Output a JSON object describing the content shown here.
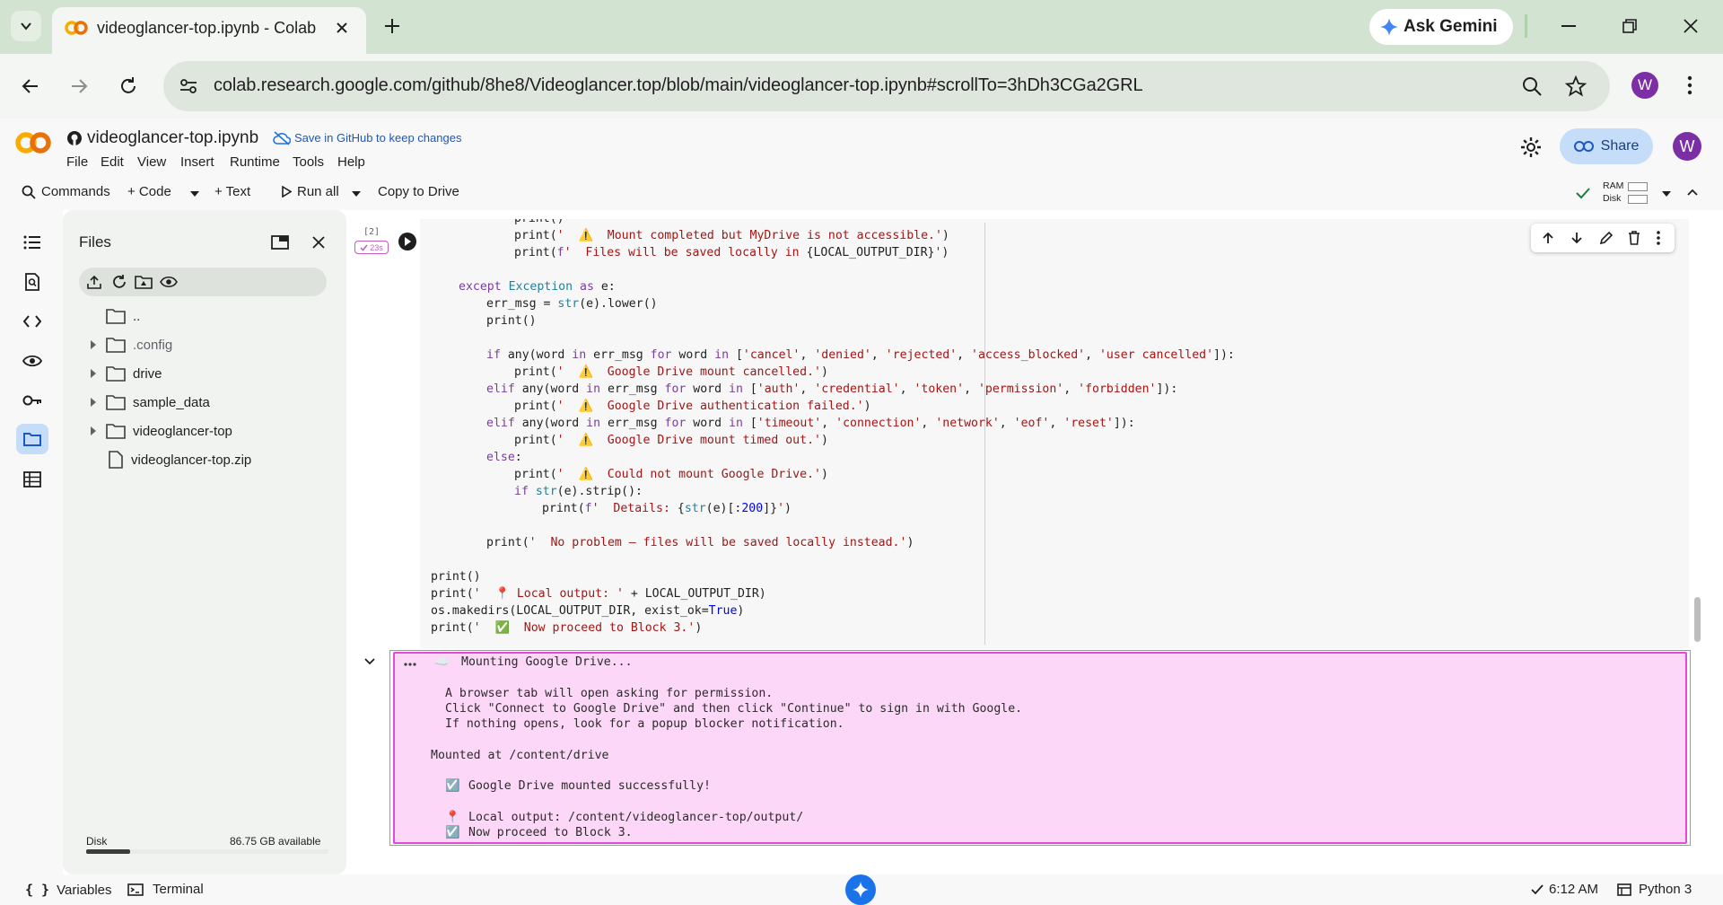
{
  "browser": {
    "tab_title": "videoglancer-top.ipynb - Colab",
    "url": "colab.research.google.com/github/8he8/Videoglancer.top/blob/main/videoglancer-top.ipynb#scrollTo=3hDh3CGa2GRL",
    "gemini_label": "Ask Gemini",
    "profile_initial": "W"
  },
  "colab": {
    "notebook_name": "videoglancer-top.ipynb",
    "save_github": "Save in GitHub to keep changes",
    "share_label": "Share",
    "avatar_initial": "W",
    "menu": [
      "File",
      "Edit",
      "View",
      "Insert",
      "Runtime",
      "Tools",
      "Help"
    ],
    "toolbar": {
      "commands": "Commands",
      "code": "+ Code",
      "text": "+ Text",
      "run_all": "Run all",
      "copy_to_drive": "Copy to Drive",
      "ram_label": "RAM",
      "disk_label": "Disk"
    }
  },
  "files": {
    "title": "Files",
    "items": [
      {
        "name": "..",
        "type": "folder",
        "expandable": false
      },
      {
        "name": ".config",
        "type": "folder",
        "expandable": true
      },
      {
        "name": "drive",
        "type": "folder",
        "expandable": true
      },
      {
        "name": "sample_data",
        "type": "folder",
        "expandable": true
      },
      {
        "name": "videoglancer-top",
        "type": "folder",
        "expandable": true
      },
      {
        "name": "videoglancer-top.zip",
        "type": "file",
        "expandable": false
      }
    ],
    "disk_label": "Disk",
    "disk_available": "86.75 GB available",
    "disk_used_fraction": 0.18
  },
  "cell": {
    "exec_count": "[2]",
    "exec_time": "23s"
  },
  "statusbar": {
    "variables": "Variables",
    "terminal": "Terminal",
    "time": "6:12 AM",
    "kernel": "Python 3"
  },
  "output": {
    "line1": "Mounting Google Drive...",
    "line2": "A browser tab will open asking for permission.",
    "line3": "Click \"Connect to Google Drive\" and then click \"Continue\" to sign in with Google.",
    "line4": "If nothing opens, look for a popup blocker notification.",
    "line5": "Mounted at /content/drive",
    "line6": "Google Drive mounted successfully!",
    "line7": "Local output: /content/videoglancer-top/output/",
    "line8": "Now proceed to Block 3."
  }
}
